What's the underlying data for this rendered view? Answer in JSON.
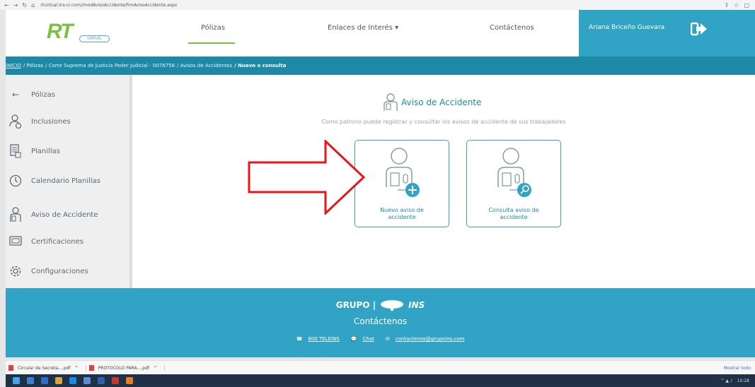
{
  "browser": {
    "url": "rtvirtual.ins-cr.com//modAvisoAccidente/frmAvisoAccidente.aspx",
    "nav_icons": [
      "back-icon",
      "forward-icon",
      "reload-icon",
      "home-icon"
    ]
  },
  "header": {
    "logo_text": "RT",
    "logo_sub": "VIRTUAL",
    "nav": [
      "Pólizas",
      "Enlaces de Interés ▾",
      "Contáctenos"
    ],
    "user_name": "Ariana Briceño Guevara"
  },
  "breadcrumb": [
    "INICIO",
    "/ Pólizas",
    "/ Corte Suprema de Justicia Poder Judicial - 0076756",
    "/ Avisos de Accidentes",
    "/ Nuevo o consulta"
  ],
  "sidebar": {
    "items": [
      {
        "label": "Pólizas",
        "icon": "back-arrow-icon"
      },
      {
        "label": "Inclusiones",
        "icon": "user-add-icon"
      },
      {
        "label": "Planillas",
        "icon": "document-icon"
      },
      {
        "label": "Calendario Planillas",
        "icon": "clock-icon"
      },
      {
        "label": "Aviso de Accidente",
        "icon": "injured-user-icon"
      },
      {
        "label": "Certificaciones",
        "icon": "certificate-icon"
      },
      {
        "label": "Configuraciones",
        "icon": "gear-icon"
      }
    ]
  },
  "main": {
    "title": "Aviso de Accidente",
    "subtitle": "Como patrono puede registrar y consultar los avisos de accidente de sus trabajadores",
    "cards": [
      {
        "line1": "Nuevo aviso de",
        "line2": "accidente"
      },
      {
        "line1": "Consulta aviso de",
        "line2": "accidente"
      }
    ]
  },
  "footer": {
    "brand_grupo": "GRUPO |",
    "brand_ins": "INS",
    "title": "Contáctenos",
    "phone": "800 TELEINS",
    "chat": "Chat",
    "email": "contactenos@grupoins.com"
  },
  "downloads": {
    "items": [
      "Circular de Secreta....pdf",
      "PROTOCOLO PARA....pdf"
    ],
    "show_all": "Mostrar todo"
  },
  "taskbar": {
    "time": "10:28"
  },
  "colors": {
    "accent": "#31a3c4",
    "dark_accent": "#1e89a6",
    "brand_green": "#7ac143",
    "arrow_red": "#e8161b"
  }
}
